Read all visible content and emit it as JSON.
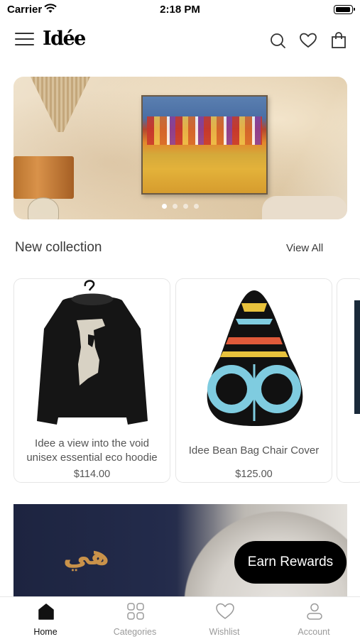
{
  "status_bar": {
    "carrier": "Carrier",
    "time": "2:18 PM"
  },
  "header": {
    "logo": "Idée"
  },
  "banner": {
    "slide_count": 4,
    "active_slide": 1
  },
  "section": {
    "title": "New collection",
    "view_all": "View All"
  },
  "products": [
    {
      "name": "Idee a view into the void unisex essential eco hoodie",
      "price": "$114.00"
    },
    {
      "name": "Idee Bean Bag Chair Cover",
      "price": "$125.00"
    }
  ],
  "promo": {
    "arabic_text": "هي"
  },
  "earn_rewards": {
    "label": "Earn Rewards"
  },
  "tabbar": {
    "tabs": [
      {
        "label": "Home",
        "icon": "home-icon",
        "active": true
      },
      {
        "label": "Categories",
        "icon": "grid-icon",
        "active": false
      },
      {
        "label": "Wishlist",
        "icon": "heart-icon",
        "active": false
      },
      {
        "label": "Account",
        "icon": "user-icon",
        "active": false
      }
    ]
  },
  "colors": {
    "accent": "#000000",
    "inactive": "#9a9a9a"
  }
}
